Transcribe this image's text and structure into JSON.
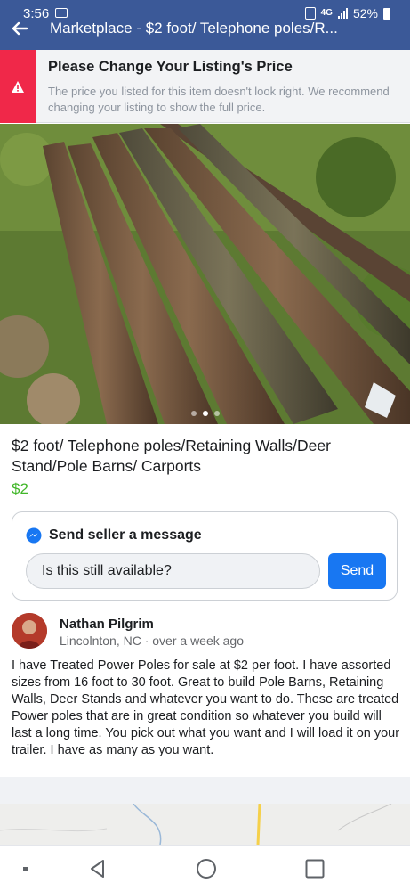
{
  "status_bar": {
    "time": "3:56",
    "network": "4G",
    "battery": "52%"
  },
  "nav": {
    "title": "Marketplace - $2 foot/ Telephone poles/R..."
  },
  "warning_banner": {
    "title": "Please Change Your Listing's Price",
    "body": "The price you listed for this item doesn't look right. We recommend changing your listing to show the full price.",
    "accent_color": "#f02849"
  },
  "photo": {
    "page_count": 3,
    "active_index": 1
  },
  "listing": {
    "title": "$2 foot/ Telephone poles/Retaining Walls/Deer Stand/Pole Barns/ Carports",
    "price": "$2",
    "price_color": "#42b72a"
  },
  "message": {
    "heading": "Send seller a message",
    "input_value": "Is this still available?",
    "send_label": "Send",
    "icon": "messenger-icon",
    "button_color": "#1877f2"
  },
  "seller": {
    "name": "Nathan Pilgrim",
    "location_time": "Lincolnton, NC · over a week ago"
  },
  "description": "I have Treated Power Poles for sale at $2 per foot. I have assorted sizes from 16 foot to 30 foot. Great to build Pole Barns, Retaining Walls, Deer Stands and whatever you want to do. These are treated Power poles that are in great condition so whatever you build will last a long time. You pick out what you want and I will load it on your trailer. I have as many as you want.",
  "system_nav": {
    "icons": [
      "recent-apps-icon",
      "back-icon",
      "home-icon",
      "overview-icon"
    ]
  },
  "theme": {
    "header_color": "#3b5998"
  }
}
